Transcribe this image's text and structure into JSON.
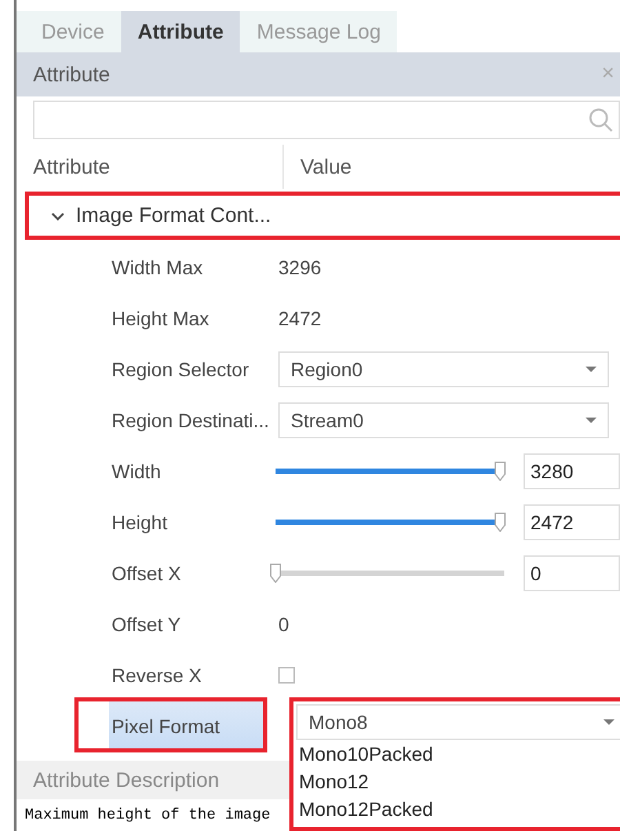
{
  "tabs": [
    {
      "label": "Device",
      "selected": false
    },
    {
      "label": "Attribute",
      "selected": true
    },
    {
      "label": "Message Log",
      "selected": false
    }
  ],
  "panel": {
    "title": "Attribute",
    "close": "×"
  },
  "columns": [
    "Attribute",
    "Value"
  ],
  "group": {
    "label": "Image Format Cont...",
    "expanded": true,
    "highlighted": true,
    "rows": [
      {
        "kind": "text",
        "label": "Width Max",
        "value": "3296"
      },
      {
        "kind": "text",
        "label": "Height Max",
        "value": "2472"
      },
      {
        "kind": "combo",
        "label": "Region Selector",
        "value": "Region0"
      },
      {
        "kind": "combo",
        "label": "Region Destinati...",
        "value": "Stream0"
      },
      {
        "kind": "slider",
        "label": "Width",
        "level": 0.98,
        "value": "3280"
      },
      {
        "kind": "slider",
        "label": "Height",
        "level": 0.98,
        "value": "2472"
      },
      {
        "kind": "slider",
        "label": "Offset X",
        "level": 0,
        "value": "0"
      },
      {
        "kind": "text",
        "label": "Offset Y",
        "value": "0"
      },
      {
        "kind": "checkbox",
        "label": "Reverse X",
        "checked": false
      },
      {
        "kind": "combo",
        "label": "Pixel Format",
        "value": "Mono8",
        "selected": true,
        "highlighted": true,
        "options": [
          "Mono10Packed",
          "Mono12",
          "Mono12Packed"
        ]
      }
    ]
  },
  "description": {
    "title": "Attribute Description",
    "text": "Maximum height of the image"
  }
}
